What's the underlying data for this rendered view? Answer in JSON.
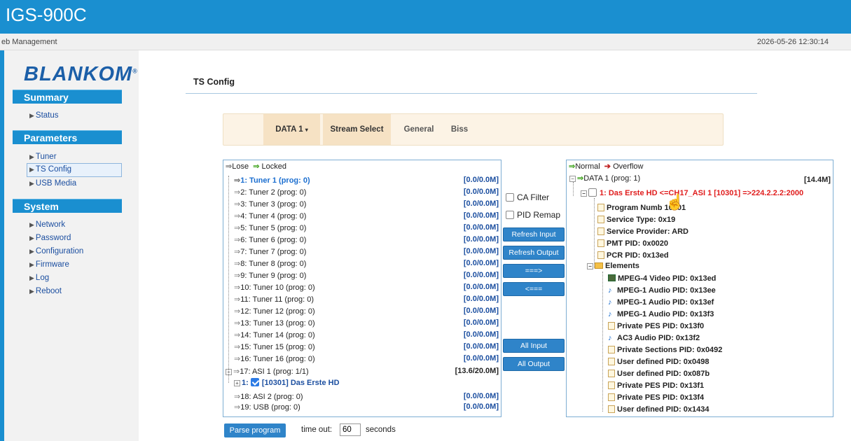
{
  "header": {
    "title": "IGS-900C",
    "subtitle": "eb Management",
    "datetime": "2026-05-26 12:30:14"
  },
  "sidebar": {
    "logo": "BLANKOM",
    "summary": {
      "title": "Summary",
      "items": [
        "Status"
      ]
    },
    "parameters": {
      "title": "Parameters",
      "items": [
        "Tuner",
        "TS Config",
        "USB Media"
      ],
      "selected": "TS Config"
    },
    "system": {
      "title": "System",
      "items": [
        "Network",
        "Password",
        "Configuration",
        "Firmware",
        "Log",
        "Reboot"
      ]
    }
  },
  "page": {
    "heading": "TS Config"
  },
  "tabs": {
    "dropdown": "DATA 1",
    "items": [
      "Stream Select",
      "General",
      "Biss"
    ],
    "active": "Stream Select"
  },
  "input_panel": {
    "legend_lose": "Lose",
    "legend_locked": "Locked",
    "rows": [
      {
        "label": "1: Tuner 1 (prog: 0)",
        "value": "[0.0/0.0M]",
        "selected": true
      },
      {
        "label": "2: Tuner 2 (prog: 0)",
        "value": "[0.0/0.0M]"
      },
      {
        "label": "3: Tuner 3 (prog: 0)",
        "value": "[0.0/0.0M]"
      },
      {
        "label": "4: Tuner 4 (prog: 0)",
        "value": "[0.0/0.0M]"
      },
      {
        "label": "5: Tuner 5 (prog: 0)",
        "value": "[0.0/0.0M]"
      },
      {
        "label": "6: Tuner 6 (prog: 0)",
        "value": "[0.0/0.0M]"
      },
      {
        "label": "7: Tuner 7 (prog: 0)",
        "value": "[0.0/0.0M]"
      },
      {
        "label": "8: Tuner 8 (prog: 0)",
        "value": "[0.0/0.0M]"
      },
      {
        "label": "9: Tuner 9 (prog: 0)",
        "value": "[0.0/0.0M]"
      },
      {
        "label": "10: Tuner 10 (prog: 0)",
        "value": "[0.0/0.0M]"
      },
      {
        "label": "11: Tuner 11 (prog: 0)",
        "value": "[0.0/0.0M]"
      },
      {
        "label": "12: Tuner 12 (prog: 0)",
        "value": "[0.0/0.0M]"
      },
      {
        "label": "13: Tuner 13 (prog: 0)",
        "value": "[0.0/0.0M]"
      },
      {
        "label": "14: Tuner 14 (prog: 0)",
        "value": "[0.0/0.0M]"
      },
      {
        "label": "15: Tuner 15 (prog: 0)",
        "value": "[0.0/0.0M]"
      },
      {
        "label": "16: Tuner 16 (prog: 0)",
        "value": "[0.0/0.0M]"
      },
      {
        "label": "17: ASI 1 (prog: 1/1)",
        "value": "[13.6/20.0M]"
      }
    ],
    "asi_child": "[10301] Das Erste HD",
    "asi_child_prefix": "1:",
    "rows_after": [
      {
        "label": "18: ASI 2 (prog: 0)",
        "value": "[0.0/0.0M]"
      },
      {
        "label": "19: USB (prog: 0)",
        "value": "[0.0/0.0M]"
      }
    ]
  },
  "middle": {
    "ca_filter": "CA Filter",
    "pid_remap": "PID Remap",
    "refresh_input": "Refresh Input",
    "refresh_output": "Refresh Output",
    "add": "===>",
    "remove": "<===",
    "all_input": "All Input",
    "all_output": "All Output"
  },
  "output_panel": {
    "legend_normal": "Normal",
    "legend_overflow": "Overflow",
    "root": "DATA 1 (prog: 1)",
    "root_rate": "[14.4M]",
    "program": "1:  Das Erste HD <=CH17_ASI 1 [10301] =>224.2.2.2:2000",
    "details": [
      "Program Numb  10301",
      "Service Type: 0x19",
      "Service Provider: ARD",
      "PMT PID: 0x0020",
      "PCR PID: 0x13ed"
    ],
    "elements_label": "Elements",
    "elements": [
      {
        "icon": "video",
        "label": "MPEG-4 Video PID: 0x13ed"
      },
      {
        "icon": "audio",
        "label": "MPEG-1 Audio PID: 0x13ee"
      },
      {
        "icon": "audio",
        "label": "MPEG-1 Audio PID: 0x13ef"
      },
      {
        "icon": "audio",
        "label": "MPEG-1 Audio PID: 0x13f3"
      },
      {
        "icon": "doc",
        "label": "Private PES PID: 0x13f0"
      },
      {
        "icon": "audio",
        "label": "AC3 Audio PID: 0x13f2"
      },
      {
        "icon": "doc",
        "label": "Private Sections PID: 0x0492"
      },
      {
        "icon": "doc",
        "label": "User defined PID: 0x0498"
      },
      {
        "icon": "doc",
        "label": "User defined PID: 0x087b"
      },
      {
        "icon": "doc",
        "label": "Private PES PID: 0x13f1"
      },
      {
        "icon": "doc",
        "label": "Private PES PID: 0x13f4"
      },
      {
        "icon": "doc",
        "label": "User defined PID: 0x1434"
      }
    ]
  },
  "footer": {
    "parse_button": "Parse program",
    "timeout_label": "time out:",
    "timeout_value": "60",
    "seconds": "seconds"
  }
}
